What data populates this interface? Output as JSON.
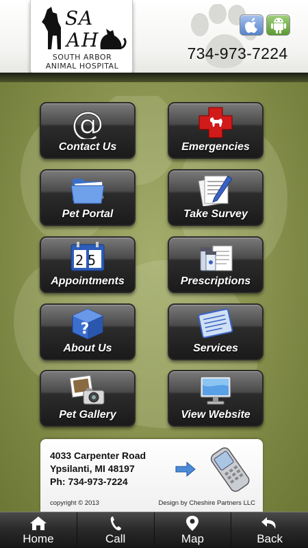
{
  "header": {
    "logo_line1": "South Arbor",
    "logo_line2": "Animal Hospital",
    "phone": "734-973-7224",
    "store_badges": [
      "apple-icon",
      "android-icon"
    ]
  },
  "tiles": [
    {
      "label": "Contact Us",
      "icon": "at-sign-icon"
    },
    {
      "label": "Emergencies",
      "icon": "red-cross-dog-icon"
    },
    {
      "label": "Pet Portal",
      "icon": "folder-icon"
    },
    {
      "label": "Take Survey",
      "icon": "survey-pen-icon"
    },
    {
      "label": "Appointments",
      "icon": "calendar-icon"
    },
    {
      "label": "Prescriptions",
      "icon": "medicine-bottles-icon"
    },
    {
      "label": "About Us",
      "icon": "question-cube-icon"
    },
    {
      "label": "Services",
      "icon": "clipboard-list-icon"
    },
    {
      "label": "Pet Gallery",
      "icon": "camera-photo-icon"
    },
    {
      "label": "View Website",
      "icon": "monitor-icon"
    }
  ],
  "calendar_digits": "25",
  "address": {
    "street": "4033 Carpenter Road",
    "city": "Ypsilanti, MI 48197",
    "phone": "Ph: 734-973-7224",
    "copyright": "copyright © 2013",
    "design": "Design by Cheshire Partners LLC"
  },
  "nav": [
    {
      "label": "Home",
      "icon": "home-icon"
    },
    {
      "label": "Call",
      "icon": "phone-handset-icon"
    },
    {
      "label": "Map",
      "icon": "map-pin-icon"
    },
    {
      "label": "Back",
      "icon": "back-arrow-icon"
    }
  ],
  "colors": {
    "background_green": "#8b9450",
    "tile_dark": "#1a1a1a",
    "emergency_red": "#d11a1a",
    "nav_dark": "#161616"
  }
}
